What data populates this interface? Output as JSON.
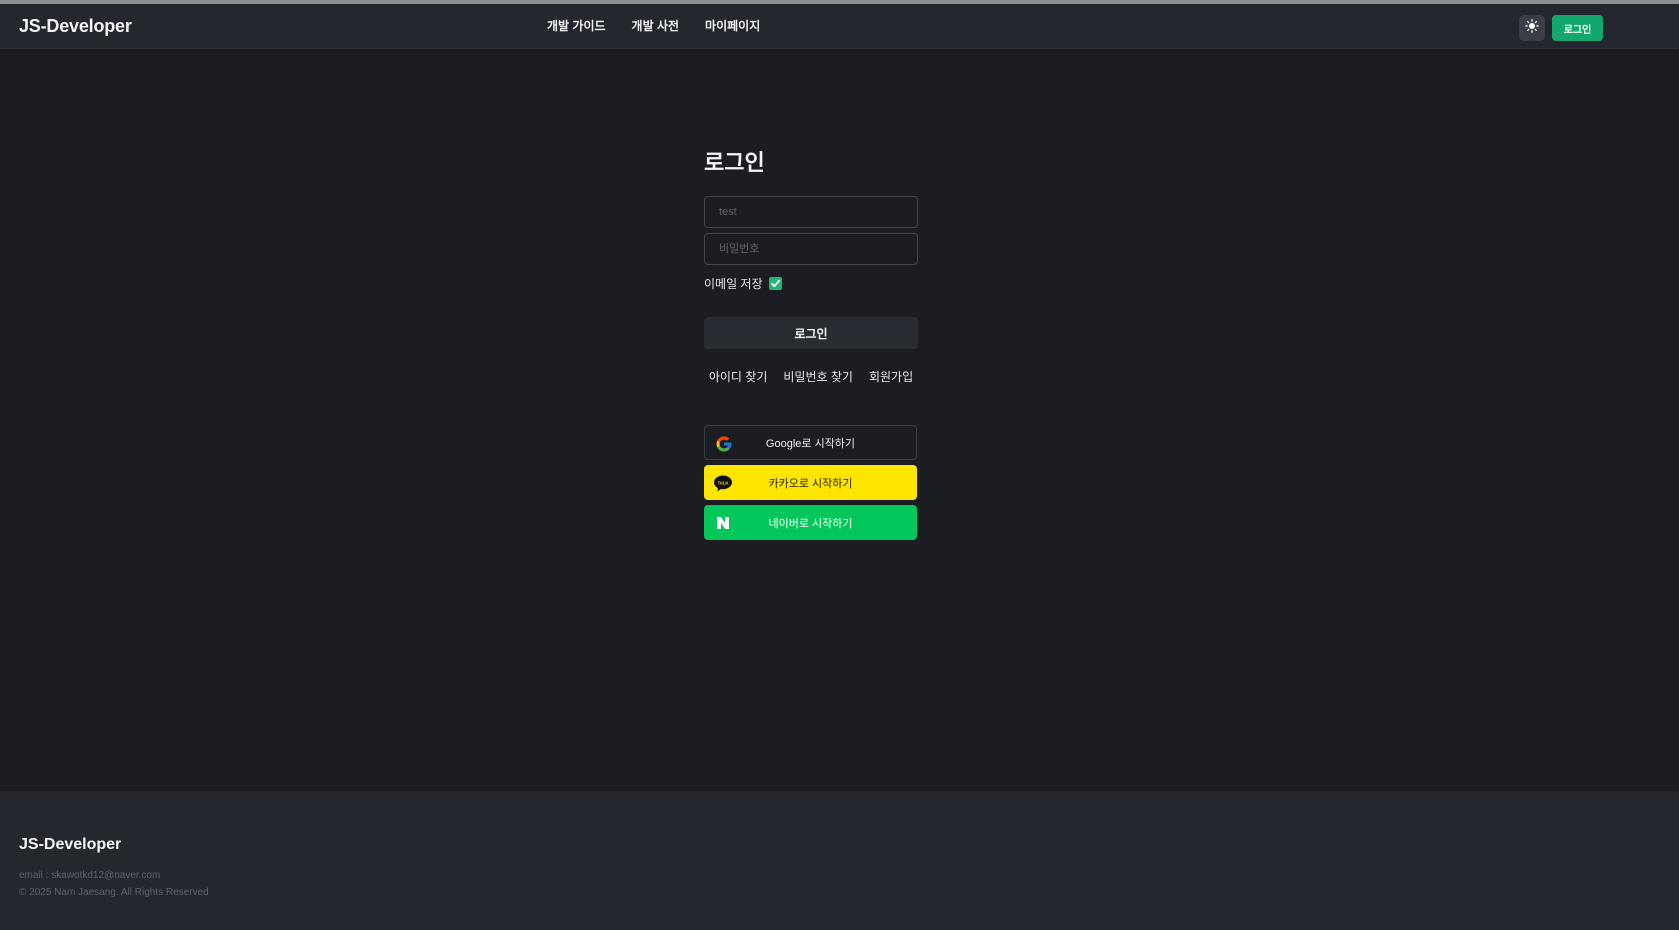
{
  "header": {
    "logo": "JS-Developer",
    "nav": [
      "개발 가이드",
      "개발 사전",
      "마이페이지"
    ],
    "theme_icon": "sun-icon",
    "login_label": "로그인",
    "accent": "#13a86b"
  },
  "login": {
    "title": "로그인",
    "email_value": "",
    "email_placeholder": "test",
    "password_placeholder": "비밀번호",
    "remember_label": "이메일 저장",
    "remember_checked": true,
    "submit_label": "로그인",
    "links": [
      "아이디 찾기",
      "비밀번호 찾기",
      "회원가입"
    ]
  },
  "social": {
    "google": {
      "label": "Google로 시작하기",
      "icon": "google-icon"
    },
    "kakao": {
      "label": "카카오로 시작하기",
      "icon": "kakao-talk-icon",
      "color": "#fee500"
    },
    "naver": {
      "label": "네이버로 시작하기",
      "icon": "naver-icon",
      "color": "#03c75a"
    }
  },
  "footer": {
    "logo": "JS-Developer",
    "email": "email : skawotkd12@naver.com",
    "copyright": "© 2025 Nam Jaesang. All Rights Reserved"
  }
}
